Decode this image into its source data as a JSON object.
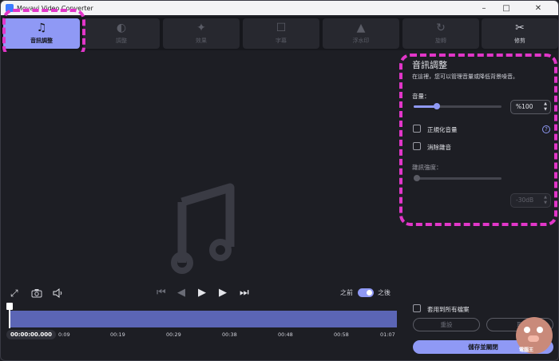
{
  "window": {
    "title": "Movavi Video Converter"
  },
  "tabs": [
    {
      "label": "音訊調整",
      "icon": "music-note-icon",
      "active": true
    },
    {
      "label": "調整",
      "icon": "adjust-icon"
    },
    {
      "label": "效果",
      "icon": "magic-wand-icon"
    },
    {
      "label": "字幕",
      "icon": "speech-bubble-icon"
    },
    {
      "label": "浮水印",
      "icon": "stamp-icon"
    },
    {
      "label": "旋轉",
      "icon": "rotate-icon"
    },
    {
      "label": "修剪",
      "icon": "scissors-icon"
    }
  ],
  "preview": {
    "placeholder_icon": "music-note-icon"
  },
  "player": {
    "before_label": "之前",
    "after_label": "之後",
    "compare_enabled": true,
    "current_time": "00:00:00.000",
    "tick_labels": [
      "0:09",
      "00:19",
      "00:29",
      "00:38",
      "00:48",
      "00:58",
      "01:07"
    ]
  },
  "audio_panel": {
    "title": "音訊調整",
    "description": "在這裡，您可以管理音量或降低背景噪音。",
    "volume_label": "音量：",
    "volume_value": "%100",
    "volume_level": 0.26,
    "normalize_label": "正規化音量",
    "normalize_checked": false,
    "denoise_label": "消除雜音",
    "denoise_checked": false,
    "noise_strength_label": "雜訊強度：",
    "noise_value": "-30dB",
    "noise_level": 0.0
  },
  "footer": {
    "apply_all_label": "套用到所有檔案",
    "apply_all_checked": false,
    "reset_label": "重設",
    "cancel_label": "取",
    "save_close_label": "儲存並關閉"
  },
  "watermark": {
    "text": "電腦王"
  },
  "colors": {
    "accent": "#8f99f5",
    "highlight": "#e236c9",
    "timeline": "#5b65b5"
  }
}
